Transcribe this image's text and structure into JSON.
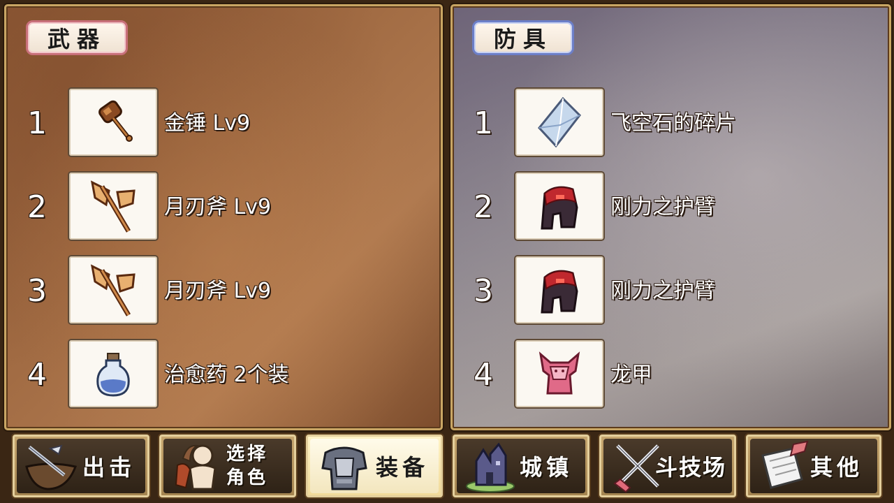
{
  "weapons": {
    "title": "武器",
    "items": [
      {
        "num": "1",
        "name": "金锤 Lv9",
        "icon": "hammer-icon"
      },
      {
        "num": "2",
        "name": "月刃斧 Lv9",
        "icon": "axe-icon"
      },
      {
        "num": "3",
        "name": "月刃斧 Lv9",
        "icon": "axe-icon"
      },
      {
        "num": "4",
        "name": "治愈药 2个装",
        "icon": "potion-icon"
      }
    ]
  },
  "armor": {
    "title": "防具",
    "items": [
      {
        "num": "1",
        "name": "飞空石的碎片",
        "icon": "crystal-icon"
      },
      {
        "num": "2",
        "name": "刚力之护臂",
        "icon": "gauntlet-icon"
      },
      {
        "num": "3",
        "name": "刚力之护臂",
        "icon": "gauntlet-icon"
      },
      {
        "num": "4",
        "name": "龙甲",
        "icon": "dragon-armor-icon"
      }
    ]
  },
  "nav": {
    "sortie": "出击",
    "select_line1": "选择",
    "select_line2": "角色",
    "equip": "装备",
    "town": "城镇",
    "arena": "斗技场",
    "other": "其他",
    "active": "equip"
  }
}
